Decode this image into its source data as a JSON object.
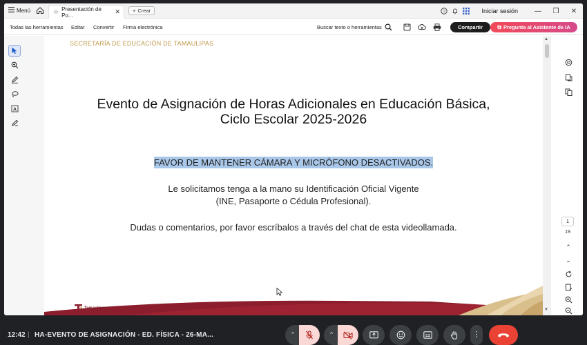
{
  "browser": {
    "menu_label": "Menú",
    "tab_title": "Presentación de Po...",
    "new_label": "Crear",
    "sign_in": "Iniciar sesión"
  },
  "toolbar": {
    "all_tools": "Todas las herramientas",
    "edit": "Editar",
    "convert": "Convertir",
    "e_sign": "Firma electrónica",
    "search": "Buscar texto o herramientas",
    "share": "Compartir",
    "ask_ai": "Pregunta al Asistente de IA"
  },
  "slide": {
    "header": "SECRETARÍA DE EDUCACIÓN DE TAMAULIPAS",
    "title_line1": "Evento de Asignación de Horas Adicionales en Educación Básica,",
    "title_line2": "Ciclo Escolar 2025-2026",
    "notice": "FAVOR DE MANTENER CÁMARA Y MICRÓFONO DESACTIVADOS.",
    "request_line1": "Le solicitamos tenga a la mano su Identificación Oficial Vigente",
    "request_line2": "(INE, Pasaporte o Cédula Profesional).",
    "doubts": "Dudas o comentarios, por favor escríbalos a través del chat de esta videollamada.",
    "logo_text": "Tamaulipas"
  },
  "pager": {
    "current": "1",
    "total": "19"
  },
  "meet": {
    "clock": "12:42",
    "separator": "|",
    "meeting_name": "HA-EVENTO DE ASIGNACIÓN - ED. FÍSICA - 26-MA..."
  },
  "colors": {
    "accent_maroon": "#8b1d2c",
    "gold": "#c19a4c",
    "highlight": "#a9c7e8",
    "leave_red": "#ea4335"
  }
}
